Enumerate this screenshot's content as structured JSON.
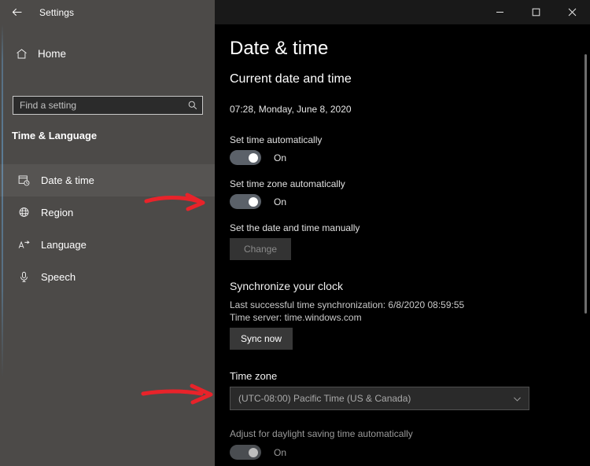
{
  "window": {
    "app_title": "Settings",
    "back_icon": "back-arrow-icon",
    "minimize_label": "Minimize",
    "maximize_label": "Maximize",
    "close_label": "Close"
  },
  "sidebar": {
    "home_label": "Home",
    "home_icon": "home-icon",
    "search": {
      "placeholder": "Find a setting",
      "value": "",
      "icon": "search-icon"
    },
    "section_title": "Time & Language",
    "items": [
      {
        "label": "Date & time",
        "icon": "calendar-clock-icon",
        "selected": true
      },
      {
        "label": "Region",
        "icon": "globe-icon",
        "selected": false
      },
      {
        "label": "Language",
        "icon": "language-icon",
        "selected": false
      },
      {
        "label": "Speech",
        "icon": "microphone-icon",
        "selected": false
      }
    ]
  },
  "main": {
    "page_title": "Date & time",
    "current_heading": "Current date and time",
    "current_value": "07:28, Monday, June 8, 2020",
    "set_time_auto": {
      "label": "Set time automatically",
      "state": "On"
    },
    "set_timezone_auto": {
      "label": "Set time zone automatically",
      "state": "On"
    },
    "manual": {
      "label": "Set the date and time manually",
      "button_label": "Change",
      "button_enabled": false
    },
    "sync": {
      "heading": "Synchronize your clock",
      "last_sync": "Last successful time synchronization: 6/8/2020 08:59:55",
      "server": "Time server: time.windows.com",
      "button_label": "Sync now",
      "button_enabled": true
    },
    "timezone": {
      "label": "Time zone",
      "selected": "(UTC-08:00) Pacific Time (US & Canada)",
      "chevron_icon": "chevron-down-icon",
      "enabled": false
    },
    "dst": {
      "label": "Adjust for daylight saving time automatically",
      "state": "On"
    }
  },
  "annotations": {
    "arrow_color": "#e8232a",
    "arrow_1_name": "red-arrow-pointing-to-set-time-zone-automatically",
    "arrow_2_name": "red-arrow-pointing-to-time-zone-dropdown"
  },
  "scrollbar": {
    "name": "vertical-scrollbar"
  }
}
